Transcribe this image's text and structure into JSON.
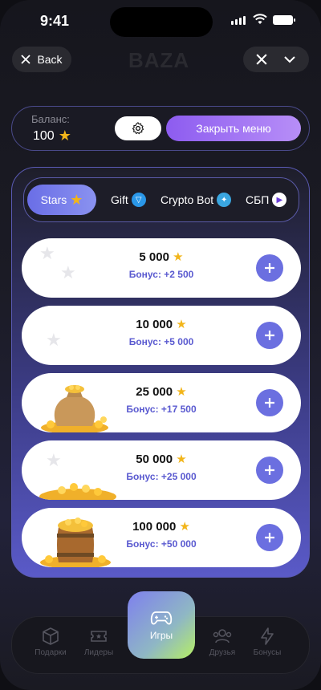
{
  "status": {
    "time": "9:41"
  },
  "header": {
    "back_label": "Back",
    "logo": "BAZA"
  },
  "balance": {
    "label": "Баланс:",
    "value": "100",
    "close_menu_label": "Закрыть меню"
  },
  "tabs": [
    {
      "label": "Stars",
      "icon": "star-icon",
      "active": true
    },
    {
      "label": "Gift",
      "icon": "gift-ton-icon"
    },
    {
      "label": "Crypto Bot",
      "icon": "crypto-bot-icon"
    },
    {
      "label": "СБП",
      "icon": "sbp-icon"
    }
  ],
  "packages": [
    {
      "amount": "5 000",
      "bonus": "Бонус: +2 500",
      "image": ""
    },
    {
      "amount": "10 000",
      "bonus": "Бонус: +5 000",
      "image": ""
    },
    {
      "amount": "25 000",
      "bonus": "Бонус: +17 500",
      "image": "coin-bag"
    },
    {
      "amount": "50 000",
      "bonus": "Бонус: +25 000",
      "image": "coin-pile"
    },
    {
      "amount": "100 000",
      "bonus": "Бонус: +50 000",
      "image": "coin-barrel"
    }
  ],
  "nav": {
    "gifts": "Подарки",
    "leaders": "Лидеры",
    "games": "Игры",
    "friends": "Друзья",
    "bonuses": "Бонусы"
  },
  "colors": {
    "accent": "#6b6fe0",
    "star": "#f2b51a",
    "bonus_text": "#5a5ad0"
  }
}
